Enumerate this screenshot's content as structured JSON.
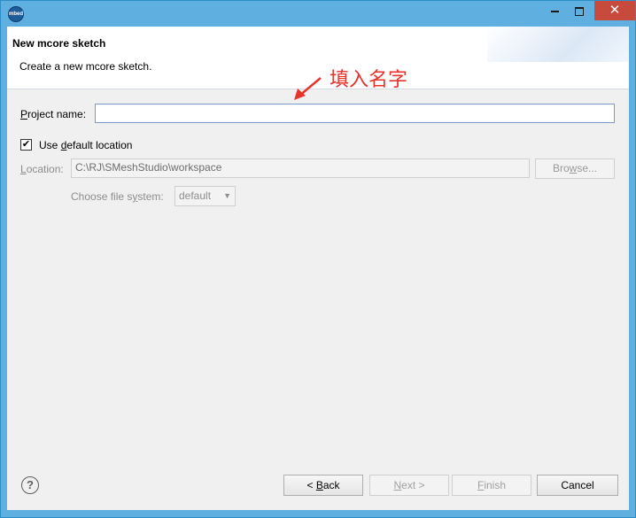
{
  "titlebar": {
    "app_icon_text": "mbed",
    "min_icon": "minimize-icon",
    "max_icon": "maximize-icon",
    "close_label": "✕"
  },
  "header": {
    "title": "New mcore sketch",
    "description": "Create a new mcore sketch."
  },
  "annotation": {
    "text": "填入名字",
    "color": "#e8322c"
  },
  "form": {
    "project_name_label_u": "P",
    "project_name_label_rest": "roject name:",
    "project_name_value": "",
    "use_default_prefix": "Use ",
    "use_default_u": "d",
    "use_default_rest": "efault location",
    "use_default_checked": "✔",
    "location_label_u": "L",
    "location_label_rest": "ocation:",
    "location_value": "C:\\RJ\\SMeshStudio\\workspace",
    "browse_u": "w",
    "browse_pre": "Bro",
    "browse_post": "se...",
    "file_system_pre": "Choose file s",
    "file_system_u": "y",
    "file_system_post": "stem:",
    "file_system_value": "default"
  },
  "footer": {
    "help_symbol": "?",
    "back_pre": "< ",
    "back_u": "B",
    "back_post": "ack",
    "next_u": "N",
    "next_post": "ext >",
    "finish_u": "F",
    "finish_post": "inish",
    "cancel_label": "Cancel"
  },
  "colors": {
    "accent": "#5fb0e0",
    "close": "#c74a3d"
  }
}
